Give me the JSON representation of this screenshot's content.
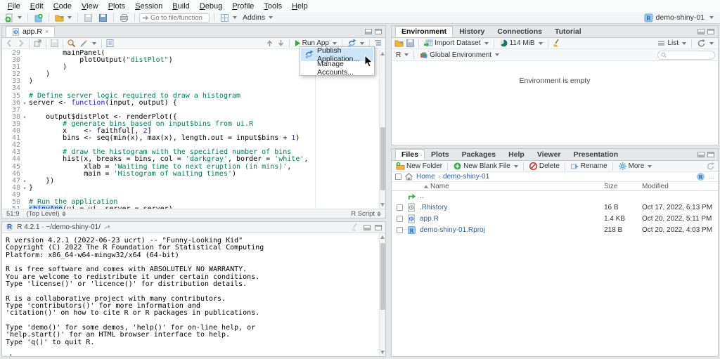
{
  "menu_bar": {
    "items": [
      "File",
      "Edit",
      "Code",
      "View",
      "Plots",
      "Session",
      "Build",
      "Debug",
      "Profile",
      "Tools",
      "Help"
    ]
  },
  "main_toolbar": {
    "goto_placeholder": "Go to file/function",
    "addins_label": "Addins",
    "project_label": "demo-shiny-01"
  },
  "editor": {
    "tab_label": "app.R",
    "run_app_label": "Run App",
    "status": {
      "position": "51:9",
      "scope": "(Top Level)",
      "file_type": "R Script"
    },
    "code": [
      {
        "n": 29,
        "fold": false,
        "segs": [
          [
            "p",
            "        mainPanel("
          ]
        ]
      },
      {
        "n": 30,
        "fold": false,
        "segs": [
          [
            "p",
            "            plotOutput("
          ],
          [
            "s",
            "\"distPlot\""
          ],
          [
            "p",
            ")"
          ]
        ]
      },
      {
        "n": 31,
        "fold": false,
        "segs": [
          [
            "p",
            "        )"
          ]
        ]
      },
      {
        "n": 32,
        "fold": false,
        "segs": [
          [
            "p",
            "    )"
          ]
        ]
      },
      {
        "n": 33,
        "fold": false,
        "segs": [
          [
            "p",
            ")"
          ]
        ]
      },
      {
        "n": 34,
        "fold": false,
        "segs": []
      },
      {
        "n": 35,
        "fold": false,
        "segs": [
          [
            "c",
            "# Define server logic required to draw a histogram"
          ]
        ]
      },
      {
        "n": 36,
        "fold": true,
        "segs": [
          [
            "p",
            "server <- "
          ],
          [
            "k",
            "function"
          ],
          [
            "p",
            "(input, output) {"
          ]
        ]
      },
      {
        "n": 37,
        "fold": false,
        "segs": []
      },
      {
        "n": 38,
        "fold": true,
        "segs": [
          [
            "p",
            "    output$distPlot <- renderPlot({"
          ]
        ]
      },
      {
        "n": 39,
        "fold": false,
        "segs": [
          [
            "c",
            "        # generate bins based on input$bins from ui.R"
          ]
        ]
      },
      {
        "n": 40,
        "fold": false,
        "segs": [
          [
            "p",
            "        x    <- faithful[, "
          ],
          [
            "n2",
            "2"
          ],
          [
            "p",
            "]"
          ]
        ]
      },
      {
        "n": 41,
        "fold": false,
        "segs": [
          [
            "p",
            "        bins <- seq(min(x), max(x), length.out = input$bins + "
          ],
          [
            "n2",
            "1"
          ],
          [
            "p",
            ")"
          ]
        ]
      },
      {
        "n": 42,
        "fold": false,
        "segs": []
      },
      {
        "n": 43,
        "fold": false,
        "segs": [
          [
            "c",
            "        # draw the histogram with the specified number of bins"
          ]
        ]
      },
      {
        "n": 44,
        "fold": false,
        "segs": [
          [
            "p",
            "        hist(x, breaks = bins, col = "
          ],
          [
            "s",
            "'darkgray'"
          ],
          [
            "p",
            ", border = "
          ],
          [
            "s",
            "'white'"
          ],
          [
            "p",
            ","
          ]
        ]
      },
      {
        "n": 45,
        "fold": false,
        "segs": [
          [
            "p",
            "             xlab = "
          ],
          [
            "s",
            "'Waiting time to next eruption (in mins)'"
          ],
          [
            "p",
            ","
          ]
        ]
      },
      {
        "n": 46,
        "fold": false,
        "segs": [
          [
            "p",
            "             main = "
          ],
          [
            "s",
            "'Histogram of waiting times'"
          ],
          [
            "p",
            ")"
          ]
        ]
      },
      {
        "n": 47,
        "fold": true,
        "segs": [
          [
            "p",
            "    })"
          ]
        ]
      },
      {
        "n": 48,
        "fold": true,
        "segs": [
          [
            "p",
            "}"
          ]
        ]
      },
      {
        "n": 49,
        "fold": false,
        "segs": []
      },
      {
        "n": 50,
        "fold": false,
        "segs": [
          [
            "c",
            "# Run the application"
          ]
        ]
      },
      {
        "n": 51,
        "fold": false,
        "segs": [
          [
            "sel",
            "shinyApp"
          ],
          [
            "p",
            "(ui = ui, server = server)"
          ]
        ]
      }
    ]
  },
  "publish_menu": {
    "items": [
      "Publish Application...",
      "Manage Accounts..."
    ]
  },
  "console": {
    "title": "R 4.2.1 · ~/demo-shiny-01/",
    "prompt": ">",
    "lines": [
      "R version 4.2.1 (2022-06-23 ucrt) -- \"Funny-Looking Kid\"",
      "Copyright (C) 2022 The R Foundation for Statistical Computing",
      "Platform: x86_64-w64-mingw32/x64 (64-bit)",
      "",
      "R is free software and comes with ABSOLUTELY NO WARRANTY.",
      "You are welcome to redistribute it under certain conditions.",
      "Type 'license()' or 'licence()' for distribution details.",
      "",
      "R is a collaborative project with many contributors.",
      "Type 'contributors()' for more information and",
      "'citation()' on how to cite R or R packages in publications.",
      "",
      "Type 'demo()' for some demos, 'help()' for on-line help, or",
      "'help.start()' for an HTML browser interface to help.",
      "Type 'q()' to quit R.",
      ""
    ]
  },
  "environment_pane": {
    "tabs": [
      "Environment",
      "History",
      "Connections",
      "Tutorial"
    ],
    "active_tab": 0,
    "toolbar": {
      "import_label": "Import Dataset",
      "memory_label": "114 MiB",
      "list_label": "List",
      "lang_label": "R",
      "scope_label": "Global Environment"
    },
    "empty_message": "Environment is empty"
  },
  "files_pane": {
    "tabs": [
      "Files",
      "Plots",
      "Packages",
      "Help",
      "Viewer",
      "Presentation"
    ],
    "active_tab": 0,
    "toolbar": {
      "new_folder": "New Folder",
      "new_blank_file": "New Blank File",
      "delete": "Delete",
      "rename": "Rename",
      "more": "More"
    },
    "breadcrumb": {
      "home": "Home",
      "current": "demo-shiny-01",
      "ellipsis": "..."
    },
    "columns": [
      "Name",
      "Size",
      "Modified"
    ],
    "rows": [
      {
        "icon": "updir",
        "name": "..",
        "size": "",
        "modified": "",
        "checkbox": false
      },
      {
        "icon": "rhistory",
        "name": ".Rhistory",
        "size": "16 B",
        "modified": "Oct 17, 2022, 6:13 PM",
        "checkbox": true
      },
      {
        "icon": "rfile",
        "name": "app.R",
        "size": "1.4 KB",
        "modified": "Oct 20, 2022, 5:11 PM",
        "checkbox": true
      },
      {
        "icon": "rproj",
        "name": "demo-shiny-01.Rproj",
        "size": "218 B",
        "modified": "Oct 20, 2022, 4:03 PM",
        "checkbox": true
      }
    ]
  }
}
